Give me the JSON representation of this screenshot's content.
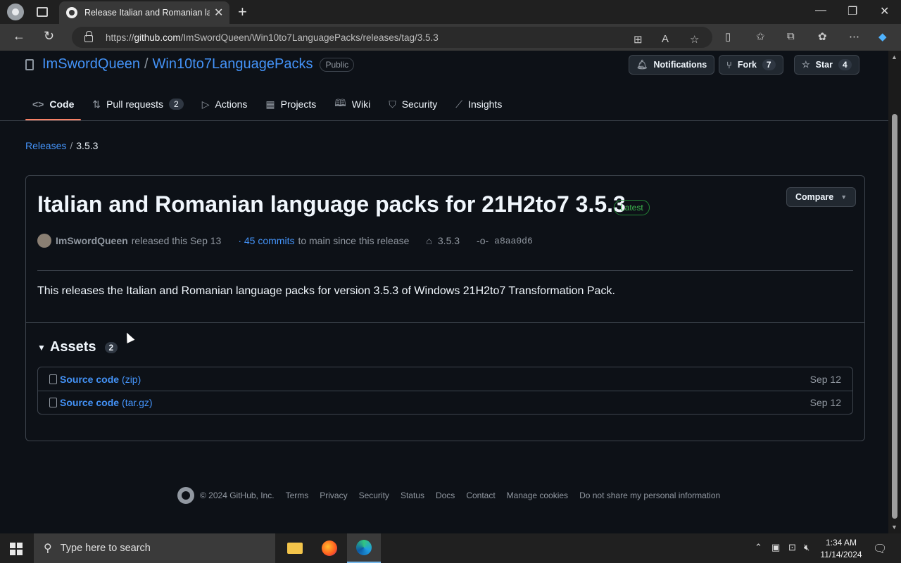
{
  "browser": {
    "tab_title": "Release Italian and Romanian lan",
    "url_prefix": "https://",
    "url_domain": "github.com",
    "url_path": "/ImSwordQueen/Win10to7LanguagePacks/releases/tag/3.5.3"
  },
  "repo": {
    "owner": "ImSwordQueen",
    "slash": "/",
    "name": "Win10to7LanguagePacks",
    "visibility": "Public",
    "notifications_label": "Notifications",
    "fork_label": "Fork",
    "fork_count": "7",
    "star_label": "Star",
    "star_count": "4"
  },
  "nav": {
    "code": "Code",
    "pull_requests": "Pull requests",
    "pull_requests_count": "2",
    "actions": "Actions",
    "projects": "Projects",
    "wiki": "Wiki",
    "security": "Security",
    "insights": "Insights"
  },
  "breadcrumb": {
    "releases": "Releases",
    "sep": "/",
    "current": "3.5.3"
  },
  "release": {
    "title": "Italian and Romanian language packs for 21H2to7 3.5.3",
    "latest_badge": "Latest",
    "compare_label": "Compare",
    "author": "ImSwordQueen",
    "released_text": "released this Sep 13",
    "commits_link": "· 45 commits",
    "commits_tail": "to main since this release",
    "tag": "3.5.3",
    "commit_sha": "a8aa0d6",
    "body": "This releases the Italian and Romanian language packs for version 3.5.3 of Windows 21H2to7 Transformation Pack."
  },
  "assets": {
    "heading": "Assets",
    "count": "2",
    "items": [
      {
        "name": "Source code",
        "ext": "(zip)",
        "date": "Sep 12"
      },
      {
        "name": "Source code",
        "ext": "(tar.gz)",
        "date": "Sep 12"
      }
    ]
  },
  "footer": {
    "copyright": "© 2024 GitHub, Inc.",
    "links": [
      "Terms",
      "Privacy",
      "Security",
      "Status",
      "Docs",
      "Contact",
      "Manage cookies",
      "Do not share my personal information"
    ]
  },
  "taskbar": {
    "search_placeholder": "Type here to search",
    "time": "1:34 AM",
    "date": "11/14/2024"
  },
  "colors": {
    "link": "#4493f8",
    "accent_underline": "#f78166",
    "latest_green": "#3fb950",
    "background": "#0d1117"
  }
}
